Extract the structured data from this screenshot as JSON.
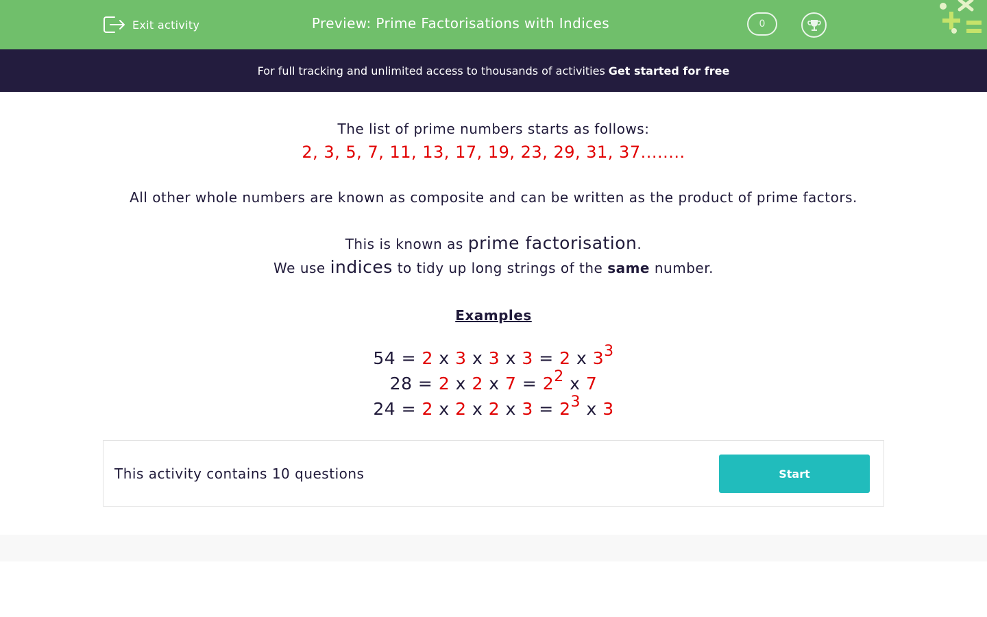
{
  "header": {
    "exit_label": "Exit activity",
    "title": "Preview: Prime Factorisations with Indices",
    "score": "0",
    "icons": [
      "exit-icon",
      "trophy-icon",
      "brand-logo-icon"
    ],
    "colors": {
      "header_bg": "#70bf6b",
      "banner_bg": "#231c3e",
      "accent_red": "#e10000",
      "start_button": "#21bcbc"
    }
  },
  "banner": {
    "text": "For full tracking and unlimited access to thousands of activities",
    "cta": "Get started for free"
  },
  "intro": {
    "primes_heading": "The list of prime numbers starts as follows:",
    "primes_list": "2, 3, 5, 7, 11, 13, 17, 19, 23, 29, 31, 37........",
    "composite_text": "All other whole numbers are known as composite and can be written as the product of prime factors.",
    "known_prefix": "This is known as ",
    "known_term": "prime factorisation",
    "known_suffix": ".",
    "indices_prefix": "We use ",
    "indices_term": "indices",
    "indices_middle": " to tidy up long strings of the ",
    "indices_bold": "same",
    "indices_suffix": " number."
  },
  "examples": {
    "heading": "Examples",
    "rows": [
      {
        "lhs": "54",
        "factors": [
          "2",
          "3",
          "3",
          "3"
        ],
        "result": [
          {
            "base": "2"
          },
          {
            "base": "3",
            "exp": "3"
          }
        ]
      },
      {
        "lhs": "28",
        "factors": [
          "2",
          "2",
          "7"
        ],
        "result": [
          {
            "base": "2",
            "exp": "2"
          },
          {
            "base": "7"
          }
        ]
      },
      {
        "lhs": "24",
        "factors": [
          "2",
          "2",
          "2",
          "3"
        ],
        "result": [
          {
            "base": "2",
            "exp": "3"
          },
          {
            "base": "3"
          }
        ]
      }
    ]
  },
  "card": {
    "text": "This activity contains 10 questions",
    "start_label": "Start"
  }
}
